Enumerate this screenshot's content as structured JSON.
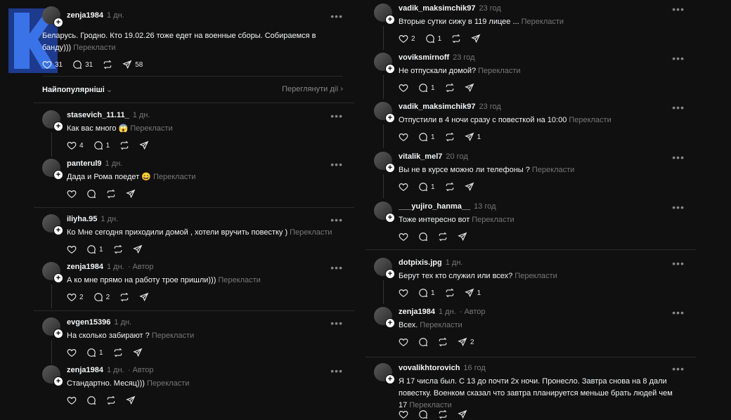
{
  "sorter": {
    "label": "Найпопулярніші",
    "view_activity": "Переглянути дії"
  },
  "translate_label": "Перекласти",
  "left": {
    "main_post": {
      "user": "zenja1984",
      "time": "1 дн.",
      "text": "Беларусь. Гродно. Кто 19.02.26 тоже едет на военные сборы. Собираемся в банду)))",
      "likes": "31",
      "replies": "31",
      "reposts": "",
      "shares": "58"
    },
    "comments": [
      {
        "user": "stasevich_11.11_",
        "time": "1 дн.",
        "text": "Как вас много 😱",
        "likes": "4",
        "replies": "1",
        "reposts": "",
        "shares": ""
      },
      {
        "user": "panterul9",
        "time": "1 дн.",
        "text": "Дада и Рома поедет 😄",
        "likes": "",
        "replies": "",
        "reposts": "",
        "shares": ""
      },
      {
        "user": "iliyha.95",
        "time": "1 дн.",
        "text": "Ко Мне сегодня приходили домой , хотели вручить повестку )",
        "likes": "",
        "replies": "1",
        "reposts": "",
        "shares": ""
      },
      {
        "user": "zenja1984",
        "time": "1 дн.",
        "author": "· Автор",
        "text": "А ко мне прямо на работу трое пришли)))",
        "likes": "2",
        "replies": "2",
        "reposts": "",
        "shares": ""
      },
      {
        "user": "evgen15396",
        "time": "1 дн.",
        "text": "На сколько забирают ?",
        "likes": "",
        "replies": "1",
        "reposts": "",
        "shares": ""
      },
      {
        "user": "zenja1984",
        "time": "1 дн.",
        "author": "· Автор",
        "text": "Стандартно. Месяц)))",
        "likes": "",
        "replies": "",
        "reposts": "",
        "shares": ""
      }
    ]
  },
  "right": {
    "comments": [
      {
        "user": "vadik_maksimchik97",
        "time": "23 год",
        "text": "Вторые сутки сижу в 119 лицее ...",
        "likes": "2",
        "replies": "1",
        "reposts": "",
        "shares": ""
      },
      {
        "user": "voviksmirnoff",
        "time": "23 год",
        "text": "Не отпускали домой?",
        "likes": "",
        "replies": "1",
        "reposts": "",
        "shares": ""
      },
      {
        "user": "vadik_maksimchik97",
        "time": "23 год",
        "text": "Отпустили в 4 ночи сразу с повесткой на 10:00",
        "likes": "",
        "replies": "1",
        "reposts": "",
        "shares": "1"
      },
      {
        "user": "vitalik_mel7",
        "time": "20 год",
        "text": "Вы не в курсе можно ли телефоны ?",
        "likes": "",
        "replies": "1",
        "reposts": "",
        "shares": ""
      },
      {
        "user": "___yujiro_hanma__",
        "time": "13 год",
        "text": "Тоже интересно вот",
        "likes": "",
        "replies": "",
        "reposts": "",
        "shares": ""
      },
      {
        "user": "dotpixis.jpg",
        "time": "1 дн.",
        "text": "Берут тех кто служил или всех?",
        "likes": "",
        "replies": "1",
        "reposts": "",
        "shares": "1"
      },
      {
        "user": "zenja1984",
        "time": "1 дн.",
        "author": "· Автор",
        "text": "Всех.",
        "likes": "",
        "replies": "",
        "reposts": "",
        "shares": "2"
      },
      {
        "user": "vovalikhtorovich",
        "time": "16 год",
        "text": "Я 17 числа был. С 13 до почти 2х ночи. Пронесло. Завтра снова на 8 дали повестку. Военком сказал что завтра планируется меньше брать людей чем 17",
        "likes": "",
        "replies": "",
        "reposts": "",
        "shares": ""
      }
    ]
  }
}
